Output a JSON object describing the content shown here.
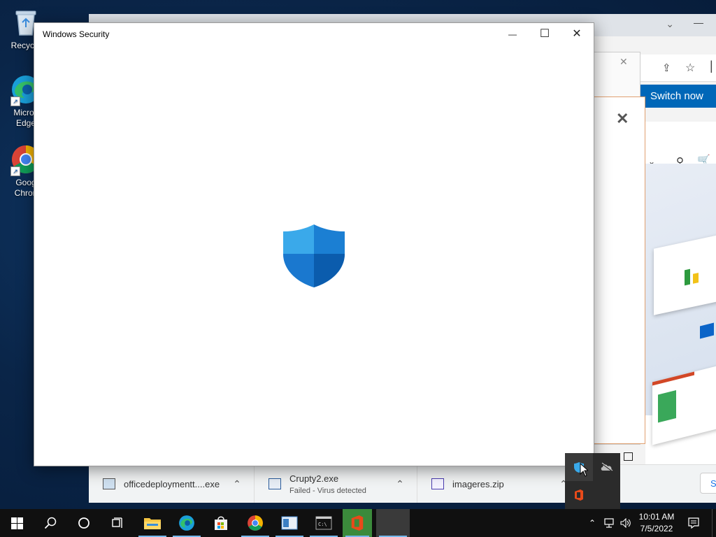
{
  "desktop": {
    "icons": [
      {
        "label": "Recycle",
        "icon": "recycle-bin-icon"
      },
      {
        "label": "Micros Edge",
        "icon": "edge-icon"
      },
      {
        "label": "Goog Chron",
        "icon": "chrome-icon"
      }
    ]
  },
  "browser": {
    "switch_now": "Switch now",
    "downloads": [
      {
        "name": "officedeploymentt....exe",
        "status": ""
      },
      {
        "name": "Crupty2.exe",
        "status": "Failed - Virus detected"
      },
      {
        "name": "imageres.zip",
        "status": ""
      }
    ],
    "show_all_partial": "S"
  },
  "security_window": {
    "title": "Windows Security",
    "minimize": "—",
    "maximize": "☐",
    "close": "✕",
    "colors": {
      "shield_light": "#38a8e8",
      "shield_dark": "#0b5fb3"
    }
  },
  "taskbar": {
    "time": "10:01 AM",
    "date": "7/5/2022",
    "apps": [
      "start-icon",
      "search-icon",
      "cortana-icon",
      "task-view-icon",
      "file-explorer-icon",
      "edge-icon",
      "store-icon",
      "chrome-icon",
      "app-icon",
      "cmd-icon",
      "office-icon",
      "blank-app"
    ]
  },
  "colors": {
    "accent": "#0067b8",
    "taskbar": "#101010",
    "desktop": "#0a2548"
  }
}
